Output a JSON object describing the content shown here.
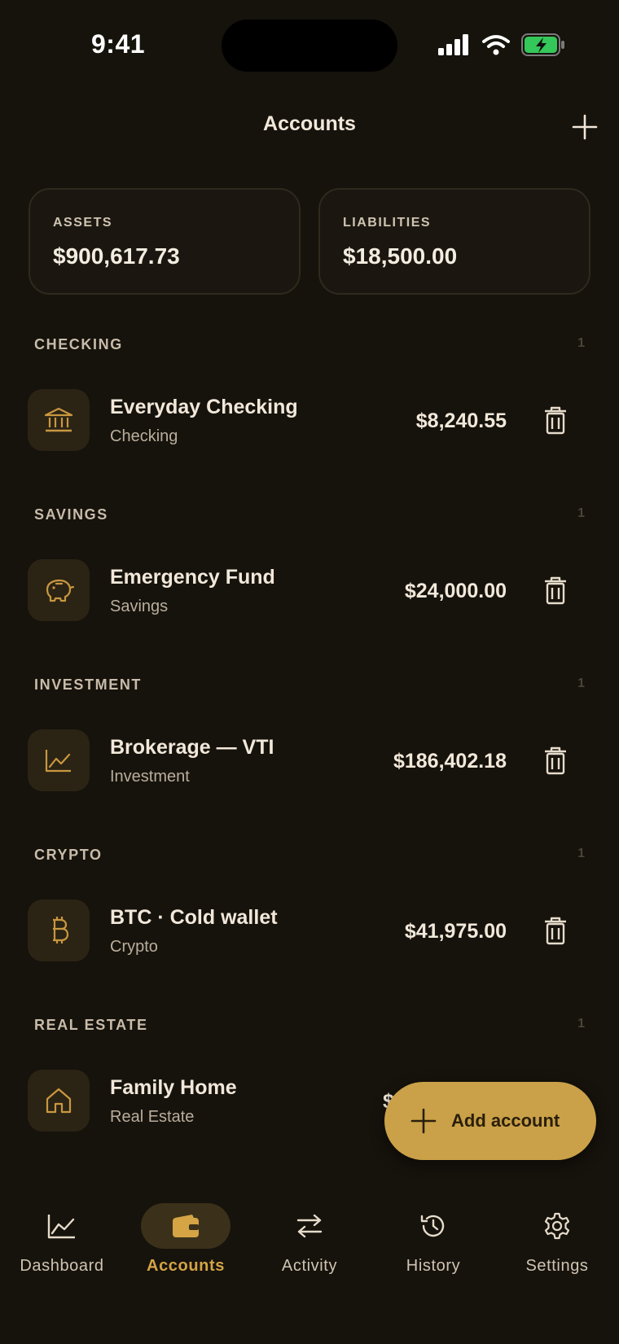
{
  "status_bar": {
    "time": "9:41",
    "icons": [
      "cellular-signal-icon",
      "wifi-icon",
      "battery-charging-icon"
    ],
    "battery_color": "#34c759"
  },
  "header": {
    "title": "Accounts",
    "add_icon": "plus-icon"
  },
  "summary": {
    "assets_label": "ASSETS",
    "assets_value": "$900,617.73",
    "liabilities_label": "LIABILITIES",
    "liabilities_value": "$18,500.00"
  },
  "sections": [
    {
      "title": "CHECKING",
      "count": "1",
      "account": {
        "name": "Everyday Checking",
        "type": "Checking",
        "balance": "$8,240.55",
        "icon": "bank-icon"
      }
    },
    {
      "title": "SAVINGS",
      "count": "1",
      "account": {
        "name": "Emergency Fund",
        "type": "Savings",
        "balance": "$24,000.00",
        "icon": "piggy-bank-icon"
      }
    },
    {
      "title": "INVESTMENT",
      "count": "1",
      "account": {
        "name": "Brokerage — VTI",
        "type": "Investment",
        "balance": "$186,402.18",
        "icon": "line-chart-icon"
      }
    },
    {
      "title": "CRYPTO",
      "count": "1",
      "account": {
        "name": "BTC · Cold wallet",
        "type": "Crypto",
        "balance": "$41,975.00",
        "icon": "bitcoin-icon"
      }
    },
    {
      "title": "REAL ESTATE",
      "count": "1",
      "account": {
        "name": "Family Home",
        "type": "Real Estate",
        "balance": "$",
        "icon": "house-icon"
      }
    }
  ],
  "fab": {
    "label": "Add account",
    "icon": "plus-icon"
  },
  "tabs": [
    {
      "label": "Dashboard",
      "icon": "chart-icon",
      "active": false
    },
    {
      "label": "Accounts",
      "icon": "wallet-icon",
      "active": true
    },
    {
      "label": "Activity",
      "icon": "transfer-arrows-icon",
      "active": false
    },
    {
      "label": "History",
      "icon": "history-icon",
      "active": false
    },
    {
      "label": "Settings",
      "icon": "gear-icon",
      "active": false
    }
  ],
  "colors": {
    "background": "#16120c",
    "accent": "#caa148",
    "accent_text": "#d4a445",
    "icon_tile": "#2b2415",
    "text_primary": "#f1e8da",
    "text_secondary": "#b9ae9c"
  }
}
